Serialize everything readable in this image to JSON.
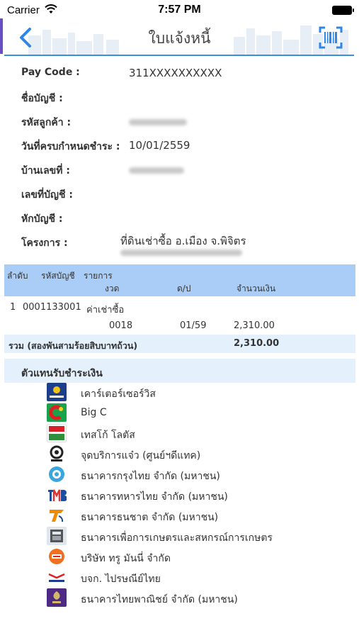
{
  "status_bar": {
    "carrier": "Carrier",
    "time": "7:57 PM"
  },
  "nav": {
    "title": "ใบแจ้งหนี้",
    "back_icon": "chevron-left-icon",
    "scan_icon": "barcode-scan-icon",
    "accent_color": "#2f86e6"
  },
  "invoice": {
    "pay_code_label": "Pay Code :",
    "pay_code_value": "311XXXXXXXXXX",
    "account_name_label": "ชื่อบัญชี :",
    "customer_code_label": "รหัสลูกค้า :",
    "due_date_label": "วันที่ครบกำหนดชำระ :",
    "due_date_value": "10/01/2559",
    "house_number_label": "บ้านเลขที่ :",
    "account_number_label": "เลขที่บัญชี :",
    "debit_account_label": "หักบัญชี :",
    "project_label": "โครงการ :",
    "project_value": "ที่ดินเช่าซื้อ อ.เมือง จ.พิจิตร"
  },
  "table": {
    "header_color": "#a9cdf6",
    "headers": {
      "seq": "ลำดับ",
      "account_code": "รหัสบัญชี",
      "item": "รายการ",
      "installment": "งวด",
      "period": "ด/ป",
      "amount": "จำนวนเงิน"
    },
    "rows": [
      {
        "seq": "1",
        "account_code": "0001133001",
        "item": "ค่าเช่าซื้อ",
        "installment": "0018",
        "period": "01/59",
        "amount": "2,310.00"
      }
    ],
    "total_label": "รวม (สองพันสามร้อยสิบบาทถ้วน)",
    "total_amount": "2,310.00"
  },
  "agents": {
    "title": "ตัวแทนรับชำระเงิน",
    "items": [
      {
        "name": "เคาร์เตอร์เซอร์วิส",
        "icon": "counter-service-logo",
        "color": "#1d3e8a"
      },
      {
        "name": "Big C",
        "icon": "big-c-logo",
        "color": "#e02020"
      },
      {
        "name": "เทสโก้ โลตัส",
        "icon": "tesco-lotus-logo",
        "color": "#2f8f3a"
      },
      {
        "name": "จุดบริการแจ๋ว (ศูนย์ฯดีแทค)",
        "icon": "jaew-service-logo",
        "color": "#222222"
      },
      {
        "name": "ธนาคารกรุงไทย จำกัด (มหาชน)",
        "icon": "krungthai-logo",
        "color": "#3aa6dd"
      },
      {
        "name": "ธนาคารทหารไทย จำกัด  (มหาชน)",
        "icon": "tmb-logo",
        "color": "#1b4ea0"
      },
      {
        "name": "ธนาคารธนชาต จำกัด (มหาชน)",
        "icon": "thanachart-logo",
        "color": "#f28a00"
      },
      {
        "name": "ธนาคารเพื่อการเกษตรและสหกรณ์การเกษตร",
        "icon": "baac-logo",
        "color": "#555555"
      },
      {
        "name": "บริษัท ทรู มันนี่ จำกัด",
        "icon": "truemoney-logo",
        "color": "#f07020"
      },
      {
        "name": "บจก. ไปรษณีย์ไทย",
        "icon": "thailand-post-logo",
        "color": "#1c3b8c"
      },
      {
        "name": "ธนาคารไทยพาณิชย์ จำกัด (มหาชน)",
        "icon": "scb-logo",
        "color": "#4e2a84"
      }
    ]
  }
}
